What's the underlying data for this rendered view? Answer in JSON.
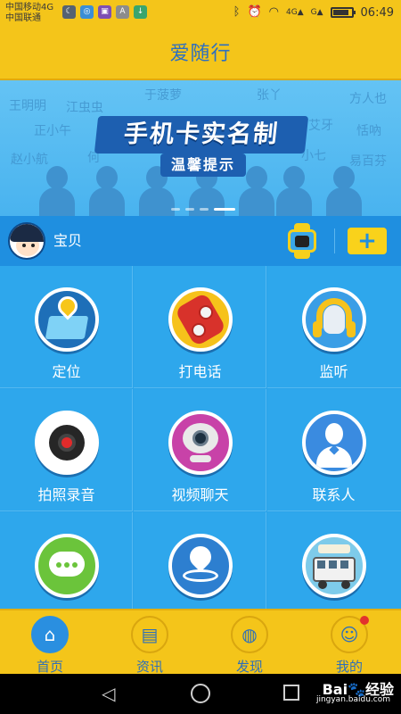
{
  "status_bar": {
    "carrier_1": "中国移动4G",
    "carrier_2": "中国联通",
    "network_1": "4G",
    "network_2": "G",
    "time": "06:49",
    "battery_level": 0.85,
    "left_icons": [
      "moon-icon",
      "browser-icon",
      "gallery-icon",
      "app-icon",
      "download-icon"
    ]
  },
  "header": {
    "title": "爱随行"
  },
  "banner": {
    "headline": "手机卡实名制",
    "subheadline": "温馨提示",
    "background_names": [
      "王明明",
      "江虫虫",
      "于菠萝",
      "张丫",
      "方人也",
      "正小午",
      "艾牙",
      "恬吶",
      "赵小航",
      "何",
      "小七",
      "易百芬"
    ],
    "slide_count": 4,
    "active_slide": 4
  },
  "profile": {
    "name": "宝贝",
    "add_label": "+"
  },
  "features": [
    {
      "label": "定位",
      "icon": "location-map-icon"
    },
    {
      "label": "打电话",
      "icon": "phone-icon"
    },
    {
      "label": "监听",
      "icon": "headphones-icon"
    },
    {
      "label": "拍照录音",
      "icon": "camera-icon"
    },
    {
      "label": "视频聊天",
      "icon": "webcam-icon"
    },
    {
      "label": "联系人",
      "icon": "contact-icon"
    },
    {
      "label": "",
      "icon": "chat-bubble-icon"
    },
    {
      "label": "",
      "icon": "navigation-pin-icon"
    },
    {
      "label": "",
      "icon": "school-bus-icon"
    }
  ],
  "tabs": [
    {
      "label": "首页",
      "icon": "home-icon",
      "active": true
    },
    {
      "label": "资讯",
      "icon": "news-icon",
      "active": false
    },
    {
      "label": "发现",
      "icon": "planet-icon",
      "active": false
    },
    {
      "label": "我的",
      "icon": "profile-icon",
      "active": false,
      "badge": true
    }
  ],
  "watermark": {
    "brand": "Bai",
    "brand_suffix": "经验",
    "url": "jingyan.baidu.com"
  },
  "colors": {
    "accent_yellow": "#f4c51a",
    "primary_blue": "#2aa3ea",
    "title_blue": "#2d6fc0",
    "badge_red": "#e2322d"
  }
}
